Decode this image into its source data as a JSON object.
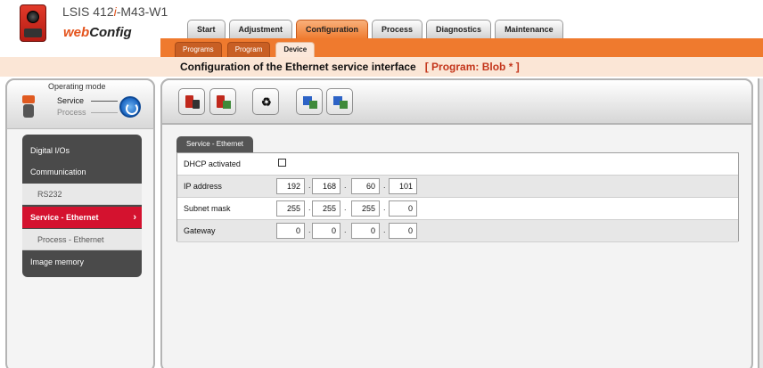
{
  "header": {
    "device_name_pre": "LSIS 412",
    "device_name_i": "i",
    "device_name_post": "-M43-W1",
    "brand_web": "web",
    "brand_config": "Config"
  },
  "main_tabs": [
    {
      "label": "Start",
      "active": false
    },
    {
      "label": "Adjustment",
      "active": false
    },
    {
      "label": "Configuration",
      "active": true
    },
    {
      "label": "Process",
      "active": false
    },
    {
      "label": "Diagnostics",
      "active": false
    },
    {
      "label": "Maintenance",
      "active": false
    }
  ],
  "sub_tabs": [
    {
      "label": "Programs",
      "active": false
    },
    {
      "label": "Program",
      "active": false
    },
    {
      "label": "Device",
      "active": true
    }
  ],
  "page": {
    "title": "Configuration of the Ethernet service interface",
    "program": "[ Program: Blob * ]"
  },
  "operating_mode": {
    "title": "Operating mode",
    "service": "Service",
    "process": "Process"
  },
  "nav": [
    {
      "label": "Digital I/Os",
      "type": "main"
    },
    {
      "label": "Communication",
      "type": "main"
    },
    {
      "label": "RS232",
      "type": "sub"
    },
    {
      "label": "Service - Ethernet",
      "type": "active"
    },
    {
      "label": "Process - Ethernet",
      "type": "sub"
    },
    {
      "label": "Image memory",
      "type": "main"
    }
  ],
  "toolbar_icons": [
    "save-to-device-icon",
    "load-from-device-icon",
    "recycle-icon",
    "upload-icon",
    "download-icon"
  ],
  "section": {
    "tab_label": "Service - Ethernet",
    "dhcp_label": "DHCP activated",
    "dhcp_checked": false,
    "rows": [
      {
        "label": "IP address",
        "octets": [
          "192",
          "168",
          "60",
          "101"
        ]
      },
      {
        "label": "Subnet mask",
        "octets": [
          "255",
          "255",
          "255",
          "0"
        ]
      },
      {
        "label": "Gateway",
        "octets": [
          "0",
          "0",
          "0",
          "0"
        ]
      }
    ]
  },
  "colors": {
    "orange": "#ef7a2e",
    "active_red": "#d4122f",
    "nav_dark": "#4a4a4a"
  }
}
